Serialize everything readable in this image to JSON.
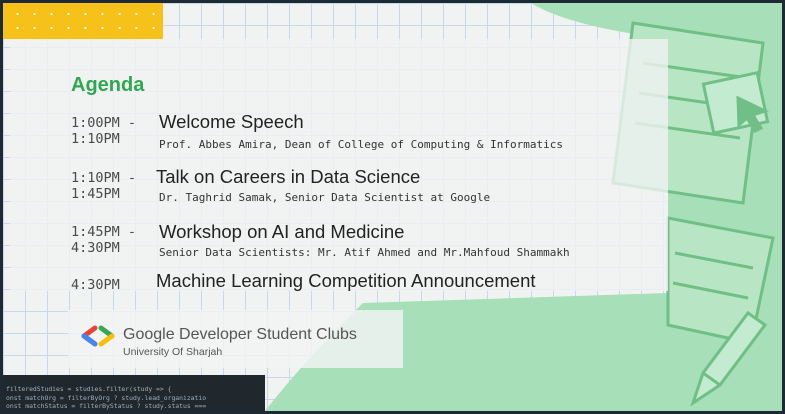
{
  "agenda": {
    "heading": "Agenda",
    "sessions": [
      {
        "start": "1:00PM -",
        "end": "1:10PM",
        "title": "Welcome Speech",
        "speaker": "Prof. Abbes Amira, Dean of College of Computing & Informatics"
      },
      {
        "start": "1:10PM -",
        "end": "1:45PM",
        "title": "Talk on Careers in Data Science",
        "speaker": "Dr. Taghrid Samak, Senior Data Scientist at Google"
      },
      {
        "start": "1:45PM -",
        "end": "4:30PM",
        "title": "Workshop on AI and Medicine",
        "speaker": "Senior Data Scientists: Mr. Atif Ahmed and Mr.Mahfoud Shammakh"
      },
      {
        "start": "4:30PM",
        "title": "Machine Learning Competition Announcement"
      }
    ]
  },
  "brand": {
    "name": "Google Developer Student Clubs",
    "subtitle": "University Of Sharjah"
  },
  "code_snippet": {
    "lines": [
      "filteredStudies = studies.filter(study => {",
      "onst matchOrg = filterByOrg ? study.lead_organizatio",
      "onst matchStatus = filterByStatus ? study.status ==="
    ]
  },
  "colors": {
    "accent_green": "#2fa84f",
    "mint_background": "#a7dfb8",
    "yellow": "#f6c21a"
  }
}
